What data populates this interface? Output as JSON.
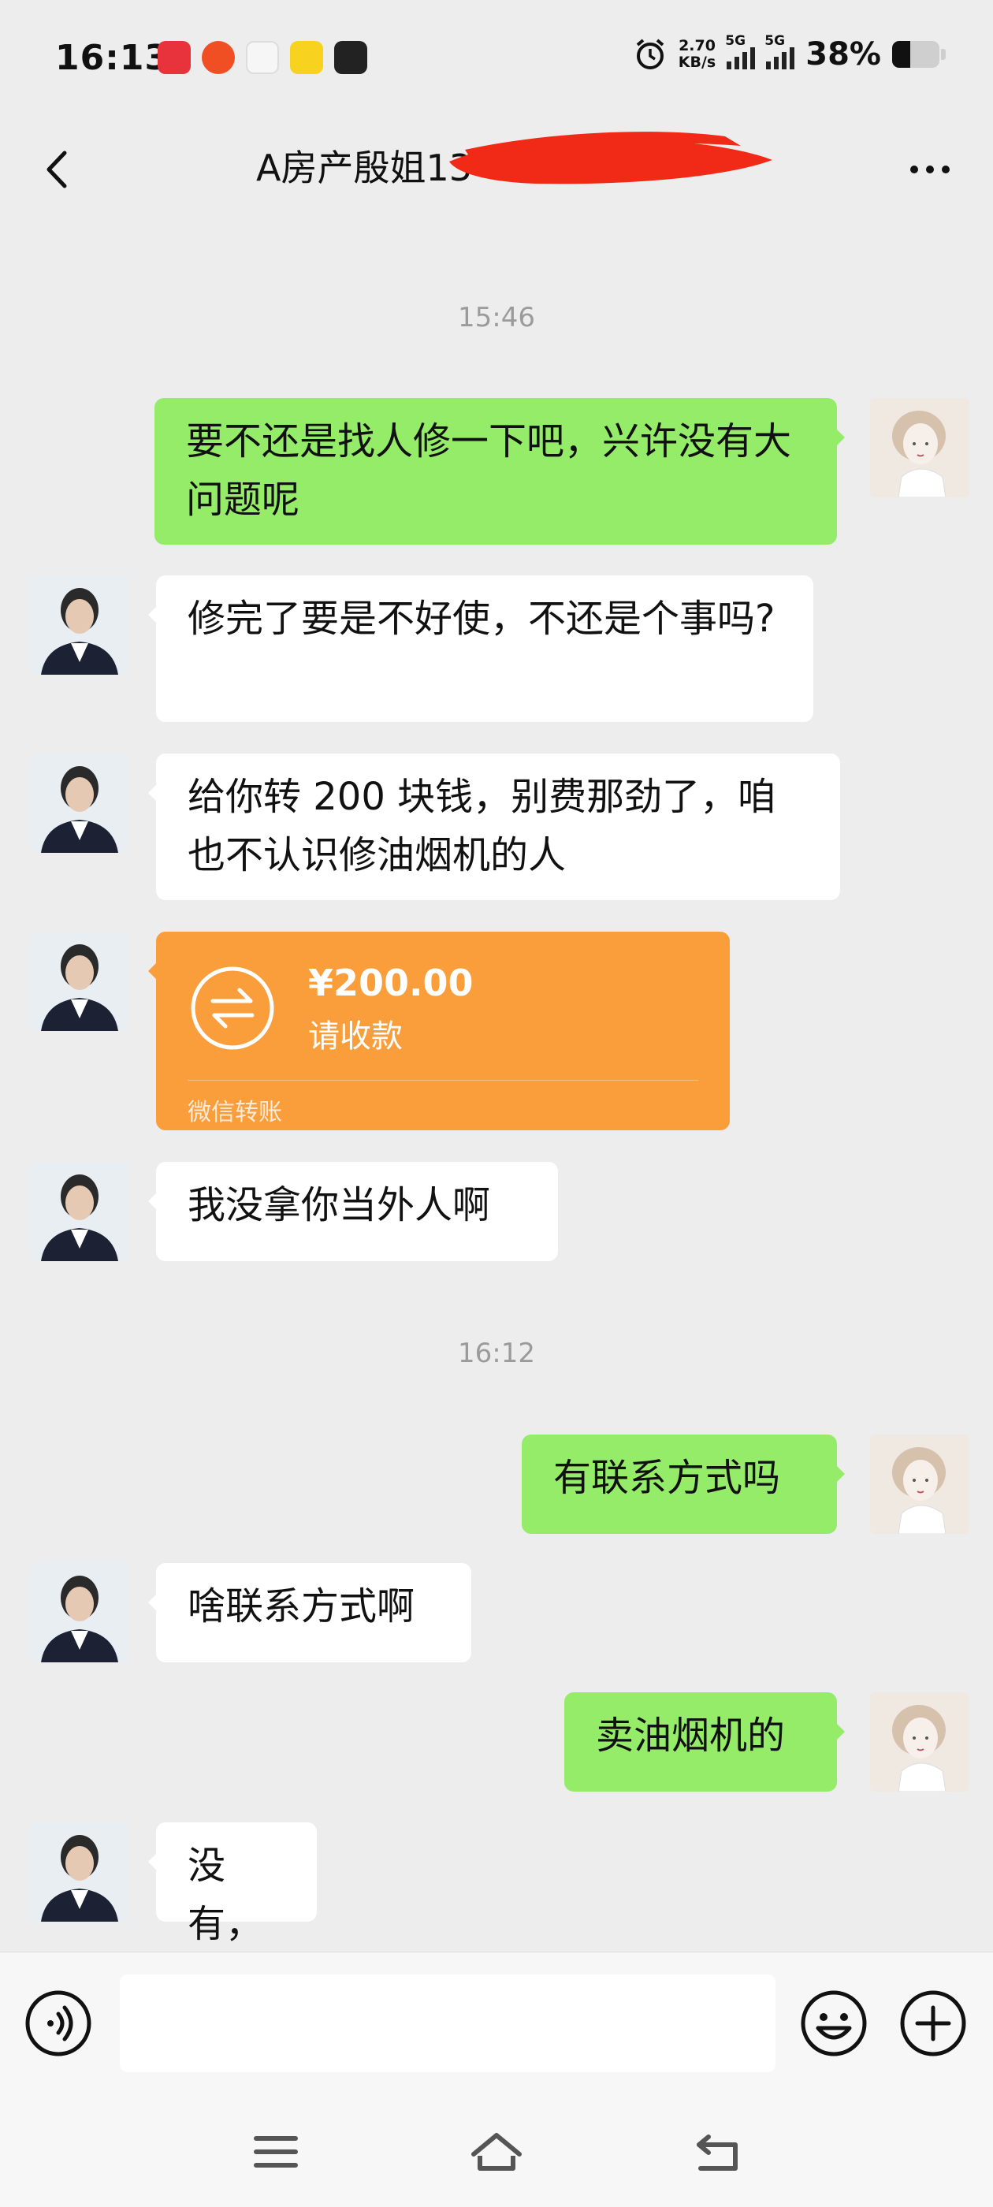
{
  "status_bar": {
    "time": "16:13",
    "net_speed_value": "2.70",
    "net_speed_unit": "KB/s",
    "sim1_label": "5G",
    "sim2_label": "5G",
    "battery_percent": "38%",
    "battery_level": 0.38,
    "app_icons": [
      "app-icon-1",
      "app-icon-2",
      "app-icon-3",
      "app-icon-4",
      "app-icon-5"
    ],
    "colors": {
      "app1": "#e8323c",
      "app2": "#f04e23",
      "app3": "#f6f6f6",
      "app4": "#f7d21e",
      "app5": "#222222"
    }
  },
  "header": {
    "title": "A房产殷姐13",
    "back_icon": "chevron-left-icon",
    "more_icon": "more-horizontal-icon",
    "redaction_color": "#f02a16"
  },
  "messages": [
    {
      "type": "time",
      "text": "15:46"
    },
    {
      "type": "text",
      "side": "out",
      "text": "要不还是找人修一下吧，兴许没有大问题呢"
    },
    {
      "type": "text",
      "side": "in",
      "text": "修完了要是不好使，不还是个事吗?"
    },
    {
      "type": "text",
      "side": "in",
      "text": "给你转 200 块钱，别费那劲了，咱也不认识修油烟机的人"
    },
    {
      "type": "transfer",
      "side": "in",
      "amount": "¥200.00",
      "note": "请收款",
      "footer": "微信转账"
    },
    {
      "type": "text",
      "side": "in",
      "text": "我没拿你当外人啊"
    },
    {
      "type": "time",
      "text": "16:12"
    },
    {
      "type": "text",
      "side": "out",
      "text": "有联系方式吗"
    },
    {
      "type": "text",
      "side": "in",
      "text": "啥联系方式啊"
    },
    {
      "type": "text",
      "side": "out",
      "text": "卖油烟机的"
    },
    {
      "type": "text",
      "side": "in",
      "text": "没有，"
    }
  ],
  "input_bar": {
    "voice_icon": "voice-icon",
    "emoji_icon": "emoji-icon",
    "plus_icon": "plus-icon",
    "text_value": ""
  },
  "nav_bar": {
    "icons": [
      "menu-icon",
      "home-icon",
      "back-icon"
    ]
  },
  "colors": {
    "background": "#ededed",
    "outgoing_bubble": "#95ec69",
    "incoming_bubble": "#ffffff",
    "transfer_card": "#fa9d3b",
    "timestamp": "#9b9b9b"
  }
}
